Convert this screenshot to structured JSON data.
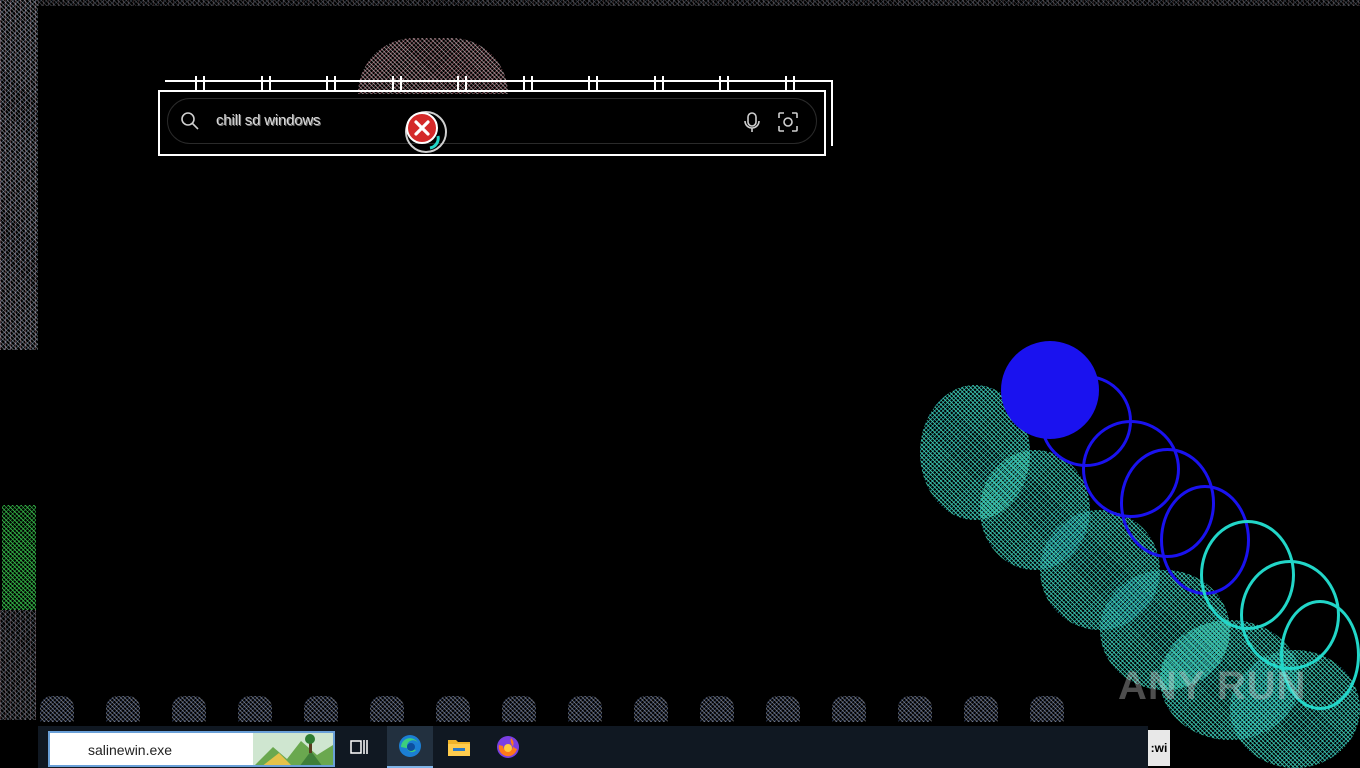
{
  "search": {
    "query": "chill sd windows",
    "icon": "search-icon",
    "voice_icon": "microphone-icon",
    "lens_icon": "visual-search-icon"
  },
  "error_icon": "error-x-icon",
  "watermark": "ANY RUN",
  "taskbar": {
    "search_text": "salinewin.exe",
    "apps": [
      {
        "name": "Task View",
        "icon": "task-view-icon"
      },
      {
        "name": "Microsoft Edge",
        "icon": "edge-icon"
      },
      {
        "name": "File Explorer",
        "icon": "folder-icon"
      },
      {
        "name": "Firefox",
        "icon": "firefox-icon"
      }
    ],
    "tray_text": ":wi"
  },
  "colors": {
    "background": "#000000",
    "orb_blue": "#1a12ef",
    "teal_trail": "#22d6c8",
    "taskbar": "#101822",
    "error_red": "#d42a2a"
  }
}
